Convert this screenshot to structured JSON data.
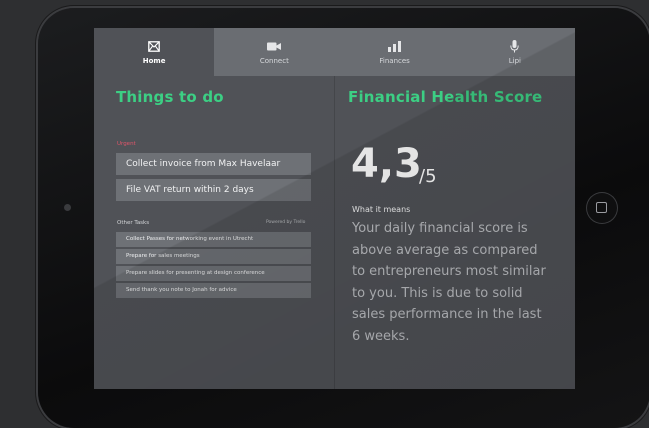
{
  "nav": {
    "tabs": [
      {
        "label": "Home",
        "icon": "envelope-icon",
        "active": true
      },
      {
        "label": "Connect",
        "icon": "video-camera-icon",
        "active": false
      },
      {
        "label": "Finances",
        "icon": "bar-chart-icon",
        "active": false
      },
      {
        "label": "Lipi",
        "icon": "microphone-icon",
        "active": false
      }
    ]
  },
  "todo": {
    "title": "Things to do",
    "urgent_label": "Urgent",
    "urgent_items": [
      "Collect invoice from Max Havelaar",
      "File VAT return within 2 days"
    ],
    "other_label": "Other Tasks",
    "powered_by": "Powered by Trello",
    "other_items": [
      "Collect Passes for networking event in Utrecht",
      "Prepare for sales meetings",
      "Prepare slides for presenting at design conference",
      "Send thank you note to Jonah for advice"
    ]
  },
  "score": {
    "title": "Financial Health Score",
    "value": "4,3",
    "denominator": "/5",
    "means_label": "What it means",
    "description": "Your daily financial score is above average as compared to entrepreneurs most similar to you. This is due to solid sales performance in the last 6 weeks."
  },
  "colors": {
    "accent_green": "#3ccf84",
    "urgent_red": "#e0556a",
    "screen_bg": "#505257",
    "nav_bg": "#6a6d72"
  }
}
